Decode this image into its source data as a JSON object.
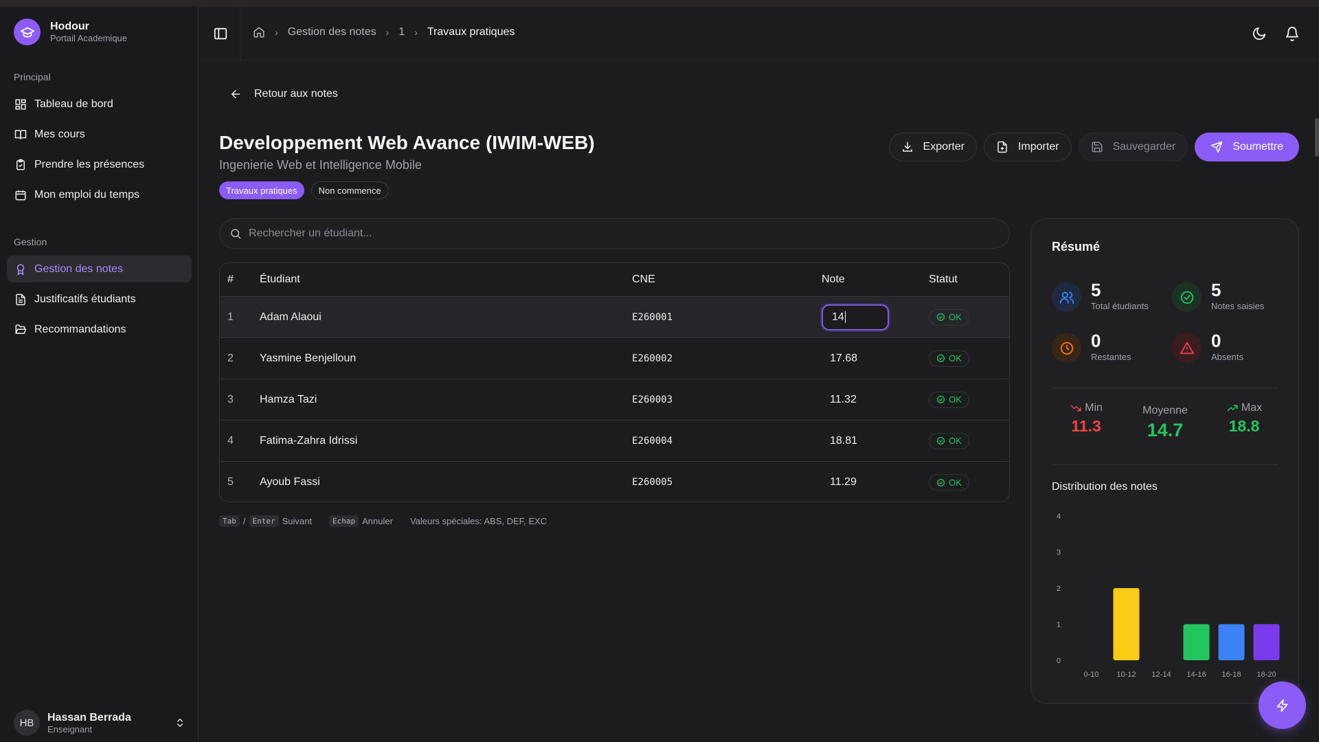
{
  "app": {
    "name": "Hodour",
    "subtitle": "Portail Academique"
  },
  "sidebar": {
    "groups": [
      {
        "label": "Principal",
        "items": [
          {
            "label": "Tableau de bord",
            "icon": "dashboard-icon"
          },
          {
            "label": "Mes cours",
            "icon": "book-icon"
          },
          {
            "label": "Prendre les présences",
            "icon": "clipboard-check-icon"
          },
          {
            "label": "Mon emploi du temps",
            "icon": "calendar-icon"
          }
        ]
      },
      {
        "label": "Gestion",
        "items": [
          {
            "label": "Gestion des notes",
            "icon": "award-icon",
            "active": true
          },
          {
            "label": "Justificatifs étudiants",
            "icon": "file-text-icon"
          },
          {
            "label": "Recommandations",
            "icon": "folder-open-icon"
          }
        ]
      }
    ]
  },
  "user": {
    "initials": "HB",
    "name": "Hassan Berrada",
    "role": "Enseignant"
  },
  "breadcrumb": {
    "items": [
      "Gestion des notes",
      "1"
    ],
    "current": "Travaux pratiques"
  },
  "page": {
    "back_label": "Retour aux notes",
    "title": "Developpement Web Avance (IWIM-WEB)",
    "subtitle": "Ingenierie Web et Intelligence Mobile",
    "tags": [
      "Travaux pratiques",
      "Non commence"
    ]
  },
  "actions": {
    "export": "Exporter",
    "import": "Importer",
    "save": "Sauvegarder",
    "submit": "Soumettre"
  },
  "search": {
    "placeholder": "Rechercher un étudiant..."
  },
  "table": {
    "headers": {
      "num": "#",
      "student": "Étudiant",
      "cne": "CNE",
      "note": "Note",
      "status": "Statut"
    },
    "rows": [
      {
        "num": "1",
        "name": "Adam Alaoui",
        "cne": "E260001",
        "note": "14",
        "status": "OK"
      },
      {
        "num": "2",
        "name": "Yasmine Benjelloun",
        "cne": "E260002",
        "note": "17.68",
        "status": "OK"
      },
      {
        "num": "3",
        "name": "Hamza Tazi",
        "cne": "E260003",
        "note": "11.32",
        "status": "OK"
      },
      {
        "num": "4",
        "name": "Fatima-Zahra Idrissi",
        "cne": "E260004",
        "note": "18.81",
        "status": "OK"
      },
      {
        "num": "5",
        "name": "Ayoub Fassi",
        "cne": "E260005",
        "note": "11.29",
        "status": "OK"
      }
    ]
  },
  "hints": {
    "tab": "Tab",
    "slash": "/",
    "enter": "Enter",
    "next": "Suivant",
    "esc": "Echap",
    "cancel": "Annuler",
    "special": "Valeurs spéciales: ABS, DEF, EXC"
  },
  "summary": {
    "title": "Résumé",
    "total": {
      "value": "5",
      "label": "Total étudiants"
    },
    "entered": {
      "value": "5",
      "label": "Notes saisies"
    },
    "remaining": {
      "value": "0",
      "label": "Restantes"
    },
    "absent": {
      "value": "0",
      "label": "Absents"
    },
    "min": {
      "label": "Min",
      "value": "11.3"
    },
    "avg": {
      "label": "Moyenne",
      "value": "14.7"
    },
    "max": {
      "label": "Max",
      "value": "18.8"
    },
    "distribution_title": "Distribution des notes"
  },
  "colors": {
    "accent": "#8b5cf6",
    "success": "#22c55e",
    "danger": "#ef4444",
    "warning": "#f97316",
    "info": "#3b82f6"
  },
  "chart_data": {
    "type": "bar",
    "categories": [
      "0-10",
      "10-12",
      "12-14",
      "14-16",
      "16-18",
      "18-20"
    ],
    "values": [
      0,
      2,
      0,
      1,
      1,
      1
    ],
    "bar_colors": [
      "#ef4444",
      "#facc15",
      "#f97316",
      "#22c55e",
      "#3b82f6",
      "#7c3aed"
    ],
    "ylim": [
      0,
      4
    ],
    "yticks": [
      0,
      1,
      2,
      3,
      4
    ],
    "grid": false
  }
}
